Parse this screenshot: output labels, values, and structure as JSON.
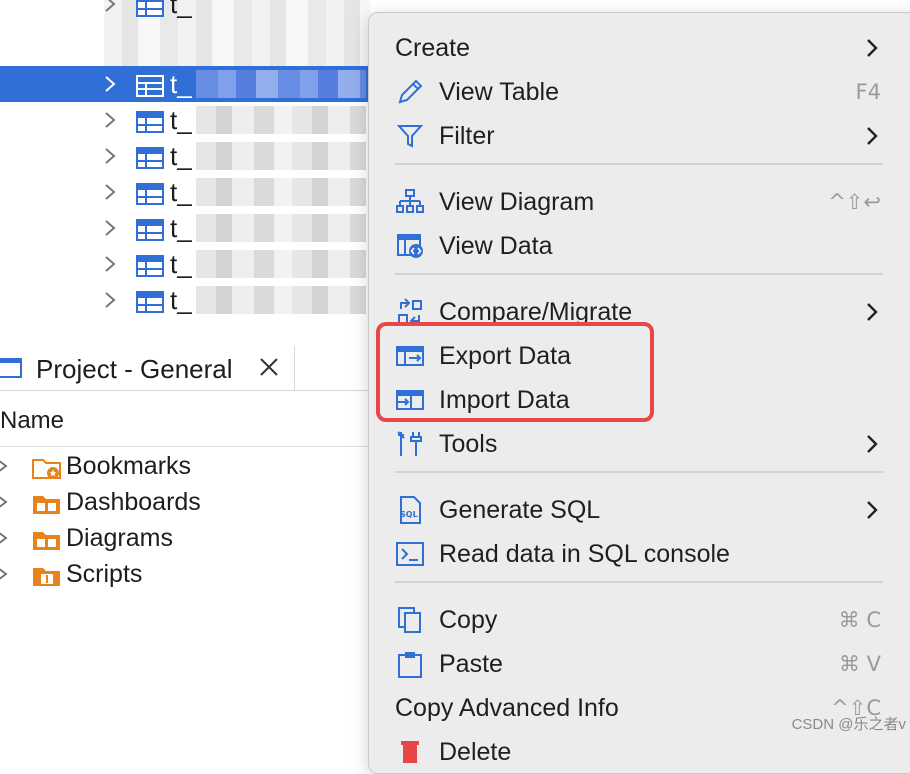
{
  "tree": {
    "rows": [
      {
        "prefix": "t_",
        "selected": false
      },
      {
        "prefix": "t_",
        "selected": true
      },
      {
        "prefix": "t_",
        "selected": false
      },
      {
        "prefix": "t_",
        "selected": false
      },
      {
        "prefix": "t_",
        "selected": false
      },
      {
        "prefix": "t_",
        "selected": false
      },
      {
        "prefix": "t_",
        "selected": false
      },
      {
        "prefix": "t_",
        "selected": false
      }
    ]
  },
  "project_panel": {
    "tab_title": "Project - General",
    "column_header": "Name",
    "items": [
      {
        "label": "Bookmarks",
        "icon": "bookmarks-folder-icon"
      },
      {
        "label": "Dashboards",
        "icon": "dashboards-folder-icon"
      },
      {
        "label": "Diagrams",
        "icon": "diagrams-folder-icon"
      },
      {
        "label": "Scripts",
        "icon": "scripts-folder-icon"
      }
    ]
  },
  "context_menu": {
    "create": {
      "label": "Create"
    },
    "view_table": {
      "label": "View Table",
      "shortcut": "F4"
    },
    "filter": {
      "label": "Filter"
    },
    "view_diagram": {
      "label": "View Diagram",
      "shortcut": "^⇧↩"
    },
    "view_data": {
      "label": "View Data"
    },
    "compare_migrate": {
      "label": "Compare/Migrate"
    },
    "export_data": {
      "label": "Export Data"
    },
    "import_data": {
      "label": "Import Data"
    },
    "tools": {
      "label": "Tools"
    },
    "generate_sql": {
      "label": "Generate SQL"
    },
    "read_data_sql": {
      "label": "Read data in SQL console"
    },
    "copy": {
      "label": "Copy",
      "shortcut": "⌘ C"
    },
    "paste": {
      "label": "Paste",
      "shortcut": "⌘ V"
    },
    "copy_advanced": {
      "label": "Copy Advanced Info",
      "shortcut": "^⇧C"
    },
    "delete": {
      "label": "Delete"
    }
  },
  "highlight_color": "#e8474a",
  "selection_color": "#2f6fd6",
  "watermark": "CSDN @乐之者v"
}
